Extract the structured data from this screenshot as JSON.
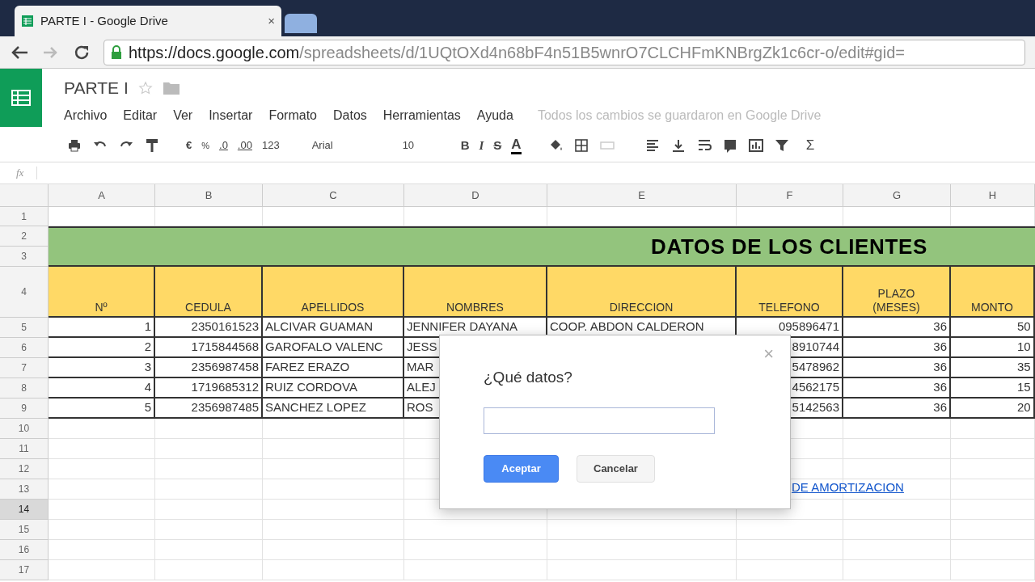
{
  "browser": {
    "tab_title": "PARTE I - Google Drive",
    "tab_close": "×",
    "url_host": "https://docs.google.com",
    "url_path": "/spreadsheets/d/1UQtOXd4n68bF4n51B5wnrO7CLCHFmKNBrgZk1c6cr-o/edit#gid="
  },
  "document": {
    "title": "PARTE I",
    "starred": false
  },
  "menu": [
    "Archivo",
    "Editar",
    "Ver",
    "Insertar",
    "Formato",
    "Datos",
    "Herramientas",
    "Ayuda"
  ],
  "save_status": "Todos los cambios se guardaron en Google Drive",
  "toolbar": {
    "currency": "€",
    "percent": "%",
    "decrease_decimals": ".0",
    "increase_decimals": ".00",
    "more_formats": "123",
    "font": "Arial",
    "font_size": "10",
    "bold": "B",
    "italic": "I",
    "strikethrough": "S",
    "text_color": "A",
    "functions": "Σ"
  },
  "formula_bar": {
    "label": "fx"
  },
  "sheet": {
    "columns": [
      "A",
      "B",
      "C",
      "D",
      "E",
      "F",
      "G",
      "H"
    ],
    "rows": [
      {
        "label": "1",
        "selected": false
      },
      {
        "label": "2",
        "selected": false
      },
      {
        "label": "3",
        "selected": false
      },
      {
        "label": "4",
        "selected": false
      },
      {
        "label": "5",
        "selected": false
      },
      {
        "label": "6",
        "selected": false
      },
      {
        "label": "7",
        "selected": false
      },
      {
        "label": "8",
        "selected": false
      },
      {
        "label": "9",
        "selected": false
      },
      {
        "label": "10",
        "selected": false
      },
      {
        "label": "11",
        "selected": false
      },
      {
        "label": "12",
        "selected": false
      },
      {
        "label": "13",
        "selected": false
      },
      {
        "label": "14",
        "selected": true
      },
      {
        "label": "15",
        "selected": false
      },
      {
        "label": "16",
        "selected": false
      },
      {
        "label": "17",
        "selected": false
      }
    ],
    "title": "DATOS DE LOS CLIENTES",
    "headers": [
      "Nº",
      "CEDULA",
      "APELLIDOS",
      "NOMBRES",
      "DIRECCION",
      "TELEFONO",
      "PLAZO (MESES)",
      "MONTO"
    ],
    "records": [
      {
        "n": "1",
        "cedula": "2350161523",
        "apellidos": "ALCIVAR GUAMAN",
        "nombres": "JENNIFER DAYANA",
        "direccion": "COOP. ABDON CALDERON",
        "telefono": "095896471",
        "plazo": "36",
        "monto": "50"
      },
      {
        "n": "2",
        "cedula": "1715844568",
        "apellidos": "GAROFALO VALENC",
        "nombres": "JESS",
        "telefono": "8910744",
        "plazo": "36",
        "monto": "10"
      },
      {
        "n": "3",
        "cedula": "2356987458",
        "apellidos": "FAREZ ERAZO",
        "nombres": "MAR",
        "telefono": "5478962",
        "plazo": "36",
        "monto": "35"
      },
      {
        "n": "4",
        "cedula": "1719685312",
        "apellidos": "RUIZ CORDOVA",
        "nombres": "ALEJ",
        "telefono": "4562175",
        "plazo": "36",
        "monto": "15"
      },
      {
        "n": "5",
        "cedula": "2356987485",
        "apellidos": "SANCHEZ LOPEZ",
        "nombres": "ROS",
        "telefono": "5142563",
        "plazo": "36",
        "monto": "20"
      }
    ],
    "link": "DE AMORTIZACION"
  },
  "dialog": {
    "title": "¿Qué datos?",
    "close": "×",
    "buttons": [
      {
        "label": "Aceptar",
        "kind": "primary"
      },
      {
        "label": "Cancelar",
        "kind": "secondary"
      }
    ]
  }
}
